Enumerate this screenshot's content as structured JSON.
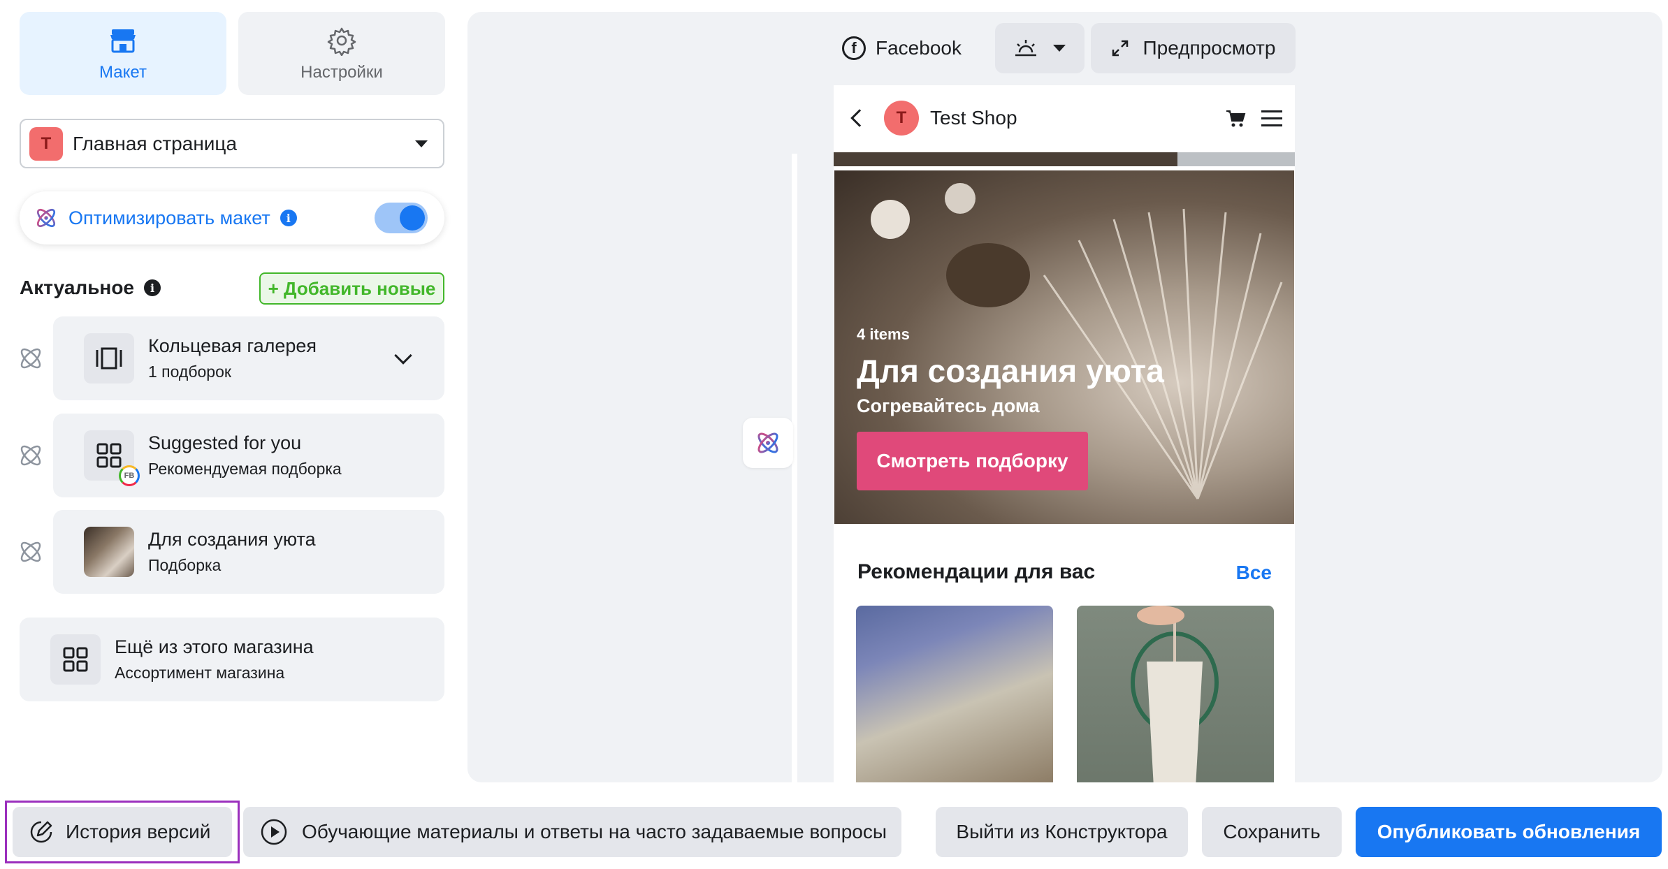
{
  "tabs": [
    {
      "label": "Макет",
      "icon": "store-icon",
      "active": true
    },
    {
      "label": "Настройки",
      "icon": "gear-icon",
      "active": false
    }
  ],
  "page_selector": {
    "avatar_letter": "T",
    "value": "Главная страница"
  },
  "optimize": {
    "label": "Оптимизировать макет",
    "enabled": true
  },
  "featured": {
    "title": "Актуальное",
    "add_button": "+ Добавить новые",
    "items": [
      {
        "title": "Кольцевая галерея",
        "subtitle": "1 подборок",
        "icon": "carousel-icon",
        "expandable": true
      },
      {
        "title": "Suggested for you",
        "subtitle": "Рекомендуемая подборка",
        "icon": "grid-icon",
        "badge": "FB"
      },
      {
        "title": "Для создания уюта",
        "subtitle": "Подборка",
        "icon": "collection-thumbnail"
      }
    ]
  },
  "more_section": {
    "title": "Ещё из этого магазина",
    "subtitle": "Ассортимент магазина",
    "icon": "grid-icon"
  },
  "preview_toolbar": {
    "platform": "Facebook",
    "theme_icon": "sunrise-icon",
    "preview_label": "Предпросмотр"
  },
  "phone": {
    "shop_letter": "T",
    "shop_name": "Test Shop",
    "hero": {
      "items_count": "4 items",
      "title": "Для создания уюта",
      "subtitle": "Согревайтесь дома",
      "button": "Смотреть подборку"
    },
    "recommendations": {
      "title": "Рекомендации для вас",
      "see_all": "Все"
    }
  },
  "bottom_bar": {
    "history": "История версий",
    "tutorials": "Обучающие материалы и ответы на часто задаваемые вопросы",
    "exit": "Выйти из Конструктора",
    "save": "Сохранить",
    "publish": "Опубликовать обновления"
  },
  "colors": {
    "accent": "#1877f2",
    "green": "#42b72a",
    "hero_button": "#e0497a",
    "highlight": "#9b2fbd"
  }
}
